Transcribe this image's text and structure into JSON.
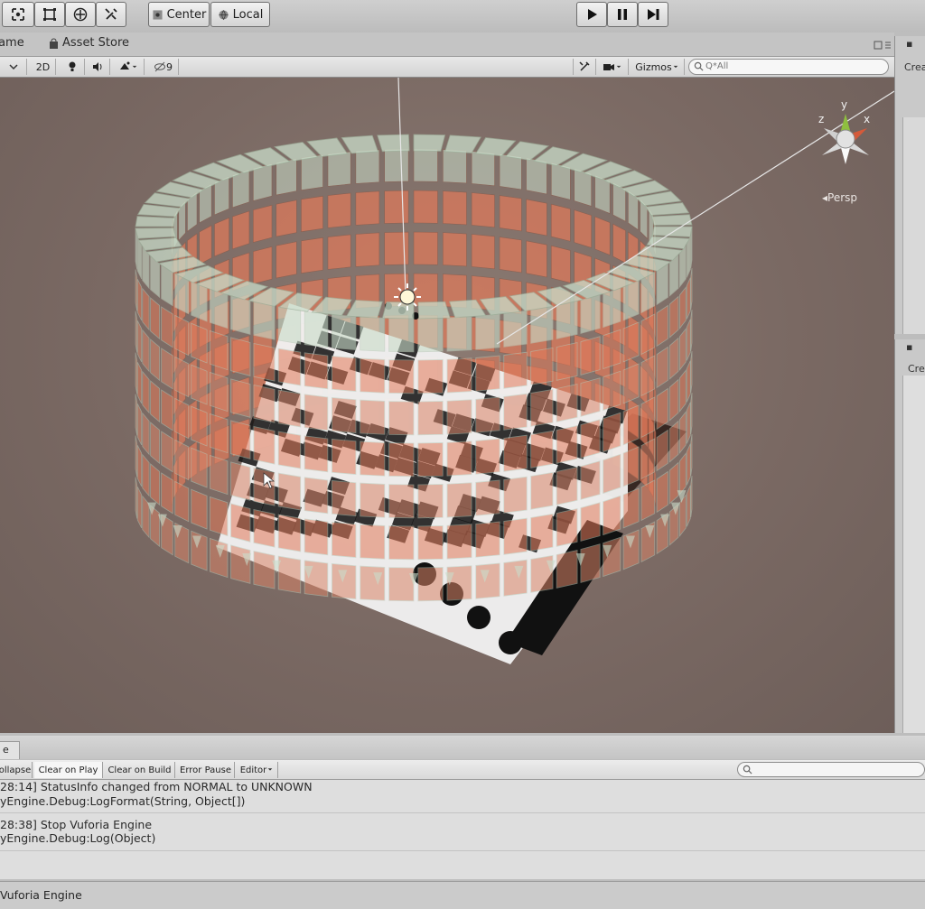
{
  "toolbar": {
    "pivot_center_label": "Center",
    "pivot_local_label": "Local",
    "tools": [
      "move-tool",
      "rect-tool",
      "transform-tool",
      "custom-tool"
    ],
    "playback": [
      "play-icon",
      "pause-icon",
      "step-icon"
    ]
  },
  "tabs": {
    "game_label": "Game",
    "asset_store_label": "Asset Store"
  },
  "scene_bar": {
    "mode_2d": "2D",
    "effects_count": "9",
    "gizmos_label": "Gizmos",
    "search_placeholder": "Q*All"
  },
  "viewport": {
    "persp_label": "Persp",
    "axis_y": "y",
    "axis_x": "x",
    "axis_z": "z",
    "colors": {
      "background": "#7a6963",
      "block_glass": "#c9dcc9",
      "block_orange": "#e27a5a",
      "marker_black": "#111111"
    }
  },
  "right_panels": {
    "hierarchy_create": "Crea",
    "project_create": "Cre"
  },
  "console": {
    "tab_label": "e",
    "buttons": [
      "ollapse",
      "Clear on Play",
      "Clear on Build",
      "Error Pause",
      "Editor"
    ],
    "logs": [
      {
        "line1": "28:14] StatusInfo changed from NORMAL to UNKNOWN",
        "line2": "yEngine.Debug:LogFormat(String, Object[])"
      },
      {
        "line1": "28:38] Stop Vuforia Engine",
        "line2": "yEngine.Debug:Log(Object)"
      }
    ],
    "status": "Vuforia Engine"
  }
}
